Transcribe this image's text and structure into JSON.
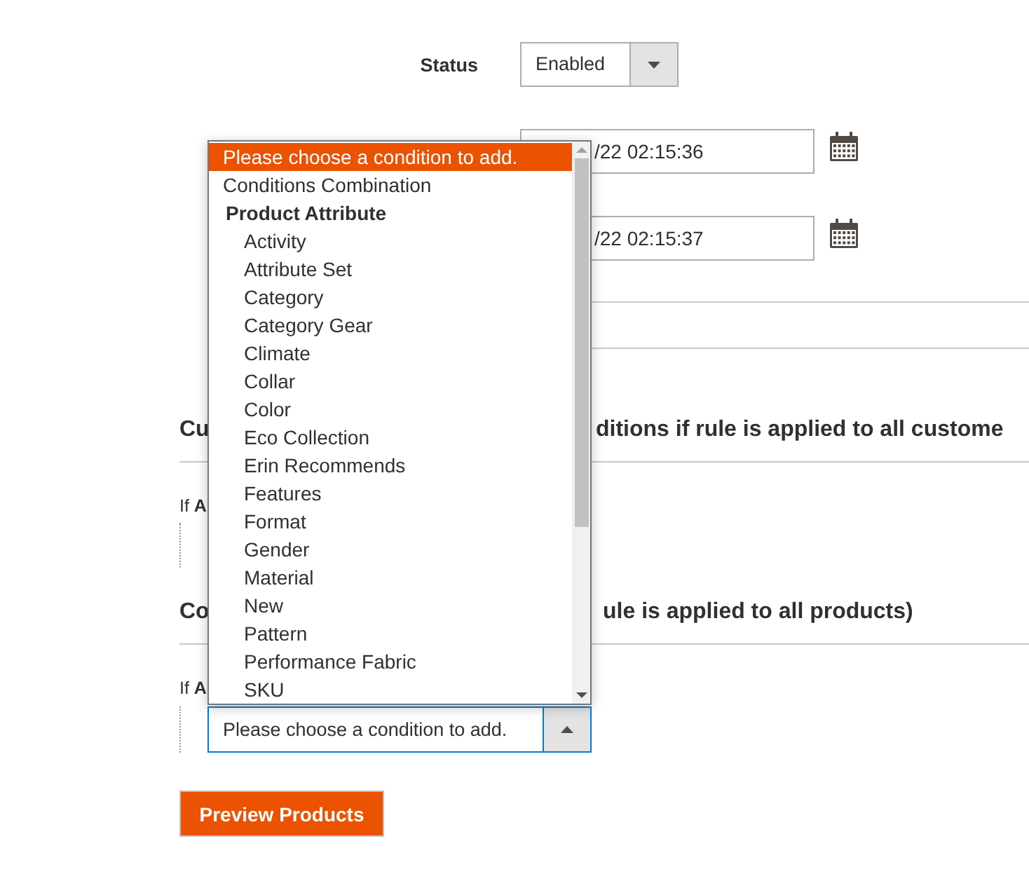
{
  "status": {
    "label": "Status",
    "value": "Enabled"
  },
  "dates": [
    {
      "value": "/22 02:15:36"
    },
    {
      "value": "/22 02:15:37"
    }
  ],
  "sections": [
    {
      "heading_left": "Cu",
      "heading_right": "ditions if rule is applied to all custome",
      "lead": "If **A**"
    },
    {
      "heading_left": "Co",
      "heading_right": "ule is applied to all products)",
      "lead": "If **A**",
      "select": {
        "value": "Please choose a condition to add.",
        "open": true
      }
    }
  ],
  "dropdown": {
    "options": [
      {
        "kind": "option",
        "label": "Please choose a condition to add.",
        "selected": true
      },
      {
        "kind": "option",
        "label": "Conditions Combination",
        "selected": false
      },
      {
        "kind": "group",
        "label": "Product Attribute",
        "children": [
          {
            "label": "Activity",
            "selected": false
          },
          {
            "label": "Attribute Set",
            "selected": false
          },
          {
            "label": "Category",
            "selected": false
          },
          {
            "label": "Category Gear",
            "selected": false
          },
          {
            "label": "Climate",
            "selected": false
          },
          {
            "label": "Collar",
            "selected": false
          },
          {
            "label": "Color",
            "selected": false
          },
          {
            "label": "Eco Collection",
            "selected": false
          },
          {
            "label": "Erin Recommends",
            "selected": false
          },
          {
            "label": "Features",
            "selected": false
          },
          {
            "label": "Format",
            "selected": false
          },
          {
            "label": "Gender",
            "selected": false
          },
          {
            "label": "Material",
            "selected": false
          },
          {
            "label": "New",
            "selected": false
          },
          {
            "label": "Pattern",
            "selected": false
          },
          {
            "label": "Performance Fabric",
            "selected": false
          },
          {
            "label": "SKU",
            "selected": false
          }
        ]
      }
    ]
  },
  "preview_button": "Preview Products"
}
